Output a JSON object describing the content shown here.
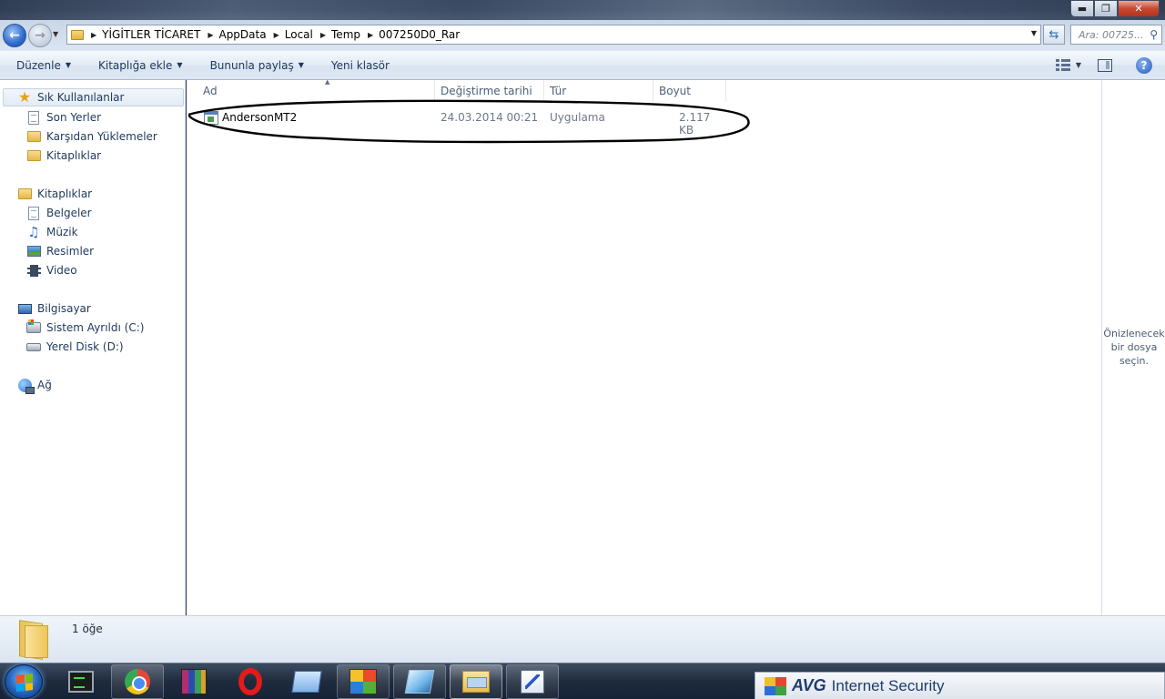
{
  "window": {
    "minimize_icon": "minimize-icon",
    "maximize_icon": "maximize-icon",
    "close_icon": "close-icon"
  },
  "address_bar": {
    "crumbs": [
      "YİGİTLER TİCARET",
      "AppData",
      "Local",
      "Temp",
      "007250D0_Rar"
    ],
    "search_placeholder": "Ara: 00725..."
  },
  "toolbar": {
    "organize": "Düzenle",
    "include_in_library": "Kitaplığa ekle",
    "share_with": "Bununla paylaş",
    "new_folder": "Yeni klasör"
  },
  "nav": {
    "favorites": {
      "label": "Sık Kullanılanlar",
      "items": [
        "Son Yerler",
        "Karşıdan Yüklemeler",
        "Kitaplıklar"
      ]
    },
    "libraries": {
      "label": "Kitaplıklar",
      "items": [
        "Belgeler",
        "Müzik",
        "Resimler",
        "Video"
      ]
    },
    "computer": {
      "label": "Bilgisayar",
      "items": [
        "Sistem Ayrıldı (C:)",
        "Yerel Disk (D:)"
      ]
    },
    "network": {
      "label": "Ağ"
    }
  },
  "columns": {
    "name": "Ad",
    "date_modified": "Değiştirme tarihi",
    "type": "Tür",
    "size": "Boyut"
  },
  "files": [
    {
      "name": "AndersonMT2",
      "date": "24.03.2014 00:21",
      "type": "Uygulama",
      "size": "2.117 KB"
    }
  ],
  "preview": {
    "line1": "Önizlenecek",
    "line2": "bir dosya",
    "line3": "seçin."
  },
  "details": {
    "item_count": "1 öğe"
  },
  "taskbar": {
    "apps": [
      "terminal-icon",
      "chrome-icon",
      "winrar-icon",
      "opera-icon",
      "media-folder-icon",
      "flying-windows-icon",
      "tiles-icon",
      "explorer-icon",
      "paint-icon"
    ],
    "notification": {
      "brand": "AVG",
      "product": "Internet Security"
    }
  }
}
